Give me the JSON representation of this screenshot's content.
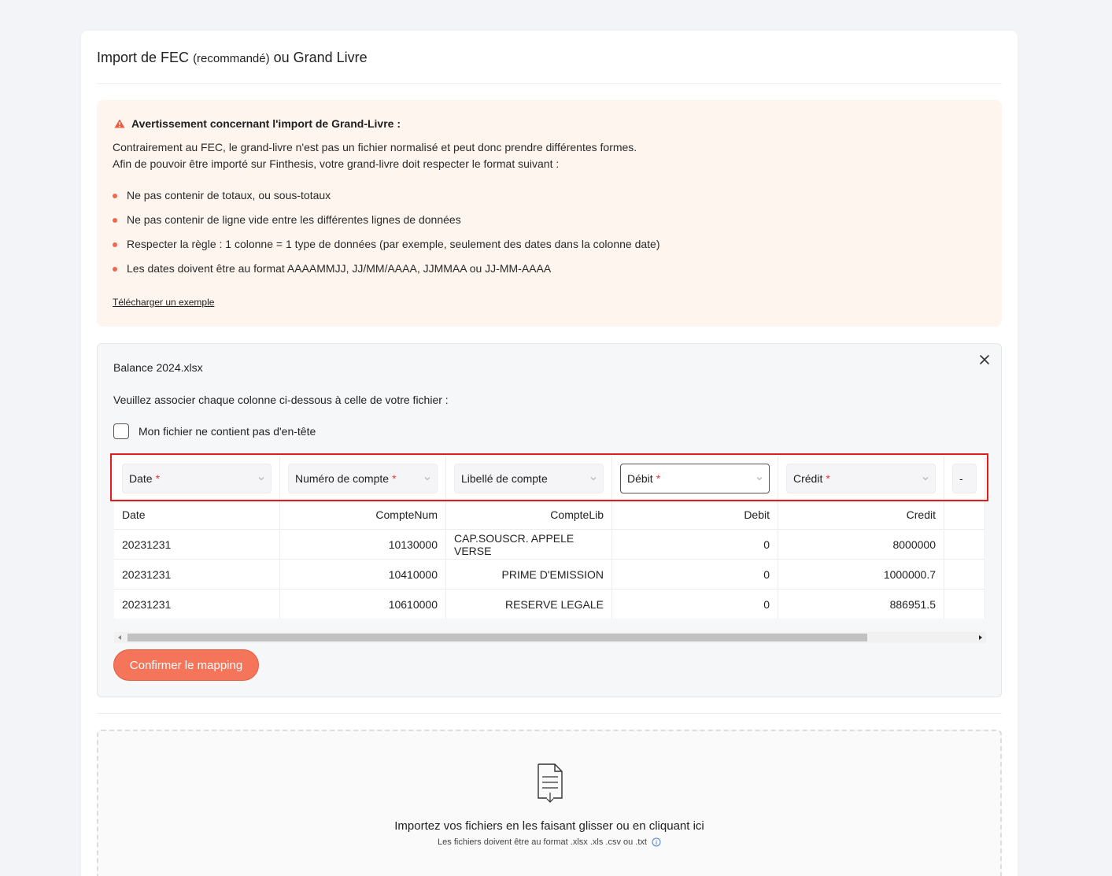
{
  "page": {
    "title_main": "Import de FEC",
    "title_paren": "(recommandé)",
    "title_end": "ou Grand Livre"
  },
  "warning": {
    "heading": "Avertissement concernant l'import de Grand-Livre :",
    "para1": "Contrairement au FEC, le grand-livre n'est pas un fichier normalisé et peut donc prendre différentes formes.",
    "para2": "Afin de pouvoir être importé sur Finthesis, votre grand-livre doit respecter le format suivant :",
    "bullets": [
      "Ne pas contenir de totaux, ou sous-totaux",
      "Ne pas contenir de ligne vide entre les différentes lignes de données",
      "Respecter la règle : 1 colonne = 1 type de données (par exemple, seulement des dates dans la colonne date)",
      "Les dates doivent être au format AAAAMMJJ, JJ/MM/AAAA, JJMMAA ou JJ-MM-AAAA"
    ],
    "download_link": "Télécharger un exemple"
  },
  "mapping": {
    "file_name": "Balance 2024.xlsx",
    "instruction": "Veuillez associer chaque colonne ci-dessous à celle de votre fichier :",
    "no_header_label": "Mon fichier ne contient pas d'en-tête",
    "selects": [
      {
        "label": "Date",
        "required": "*"
      },
      {
        "label": "Numéro de compte",
        "required": "*"
      },
      {
        "label": "Libellé de compte",
        "required": ""
      },
      {
        "label": "Débit",
        "required": "*"
      },
      {
        "label": "Crédit",
        "required": "*"
      },
      {
        "label": "-",
        "required": ""
      }
    ],
    "headers": [
      "Date",
      "CompteNum",
      "CompteLib",
      "Debit",
      "Credit",
      ""
    ],
    "rows": [
      [
        "20231231",
        "10130000",
        "CAP.SOUSCR. APPELE VERSE",
        "0",
        "8000000",
        ""
      ],
      [
        "20231231",
        "10410000",
        "PRIME D'EMISSION",
        "0",
        "1000000.7",
        ""
      ],
      [
        "20231231",
        "10610000",
        "RESERVE LEGALE",
        "0",
        "886951.5",
        ""
      ]
    ],
    "confirm_label": "Confirmer le mapping"
  },
  "dropzone": {
    "main_text": "Importez vos fichiers en les faisant glisser ou en cliquant ici",
    "sub_text": "Les fichiers doivent être au format .xlsx .xls .csv ou .txt"
  },
  "colors": {
    "accent": "#f4755a",
    "warning_bg": "#fef5ee",
    "highlight": "#e01c1c"
  }
}
